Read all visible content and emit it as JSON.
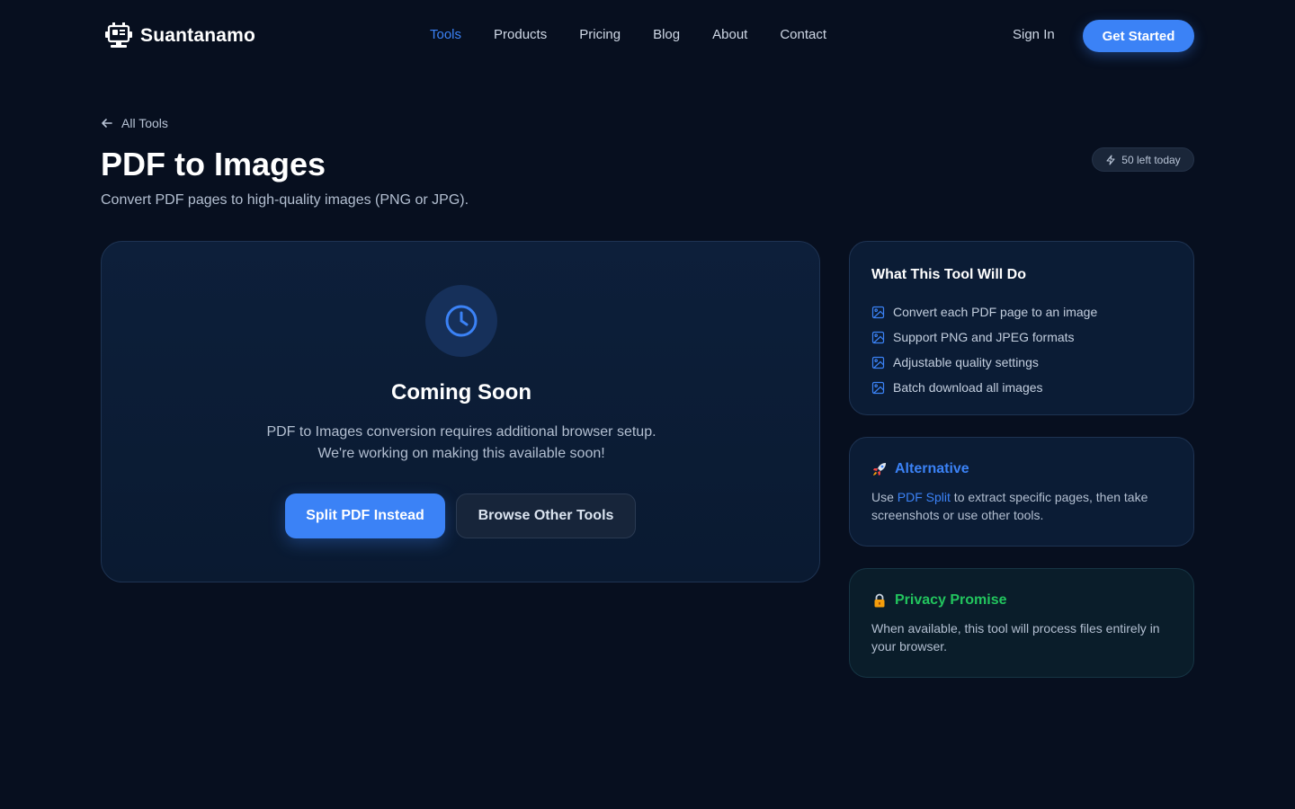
{
  "header": {
    "brand": "Suantanamo",
    "nav": [
      {
        "label": "Tools",
        "active": true
      },
      {
        "label": "Products",
        "active": false
      },
      {
        "label": "Pricing",
        "active": false
      },
      {
        "label": "Blog",
        "active": false
      },
      {
        "label": "About",
        "active": false
      },
      {
        "label": "Contact",
        "active": false
      }
    ],
    "sign_in": "Sign In",
    "get_started": "Get Started"
  },
  "breadcrumb": {
    "back_label": "All Tools",
    "icon": "arrow-left-icon"
  },
  "page": {
    "title": "PDF to Images",
    "subtitle": "Convert PDF pages to high-quality images (PNG or JPG).",
    "usage_badge": "50 left today",
    "usage_icon": "zap-icon"
  },
  "main_card": {
    "icon": "clock-icon",
    "title": "Coming Soon",
    "description": "PDF to Images conversion requires additional browser setup. We're working on making this available soon!",
    "primary_button": "Split PDF Instead",
    "secondary_button": "Browse Other Tools"
  },
  "features_card": {
    "title": "What This Tool Will Do",
    "item_icon": "image-icon",
    "items": [
      "Convert each PDF page to an image",
      "Support PNG and JPEG formats",
      "Adjustable quality settings",
      "Batch download all images"
    ]
  },
  "alternative_card": {
    "icon": "rocket-icon",
    "title": "Alternative",
    "body_prefix": "Use ",
    "link_text": "PDF Split",
    "body_suffix": " to extract specific pages, then take screenshots or use other tools."
  },
  "privacy_card": {
    "icon": "lock-icon",
    "title": "Privacy Promise",
    "body": "When available, this tool will process files entirely in your browser."
  },
  "colors": {
    "background": "#070f1f",
    "accent": "#3b82f6",
    "success": "#22c55e",
    "card": "#0b1c35"
  }
}
